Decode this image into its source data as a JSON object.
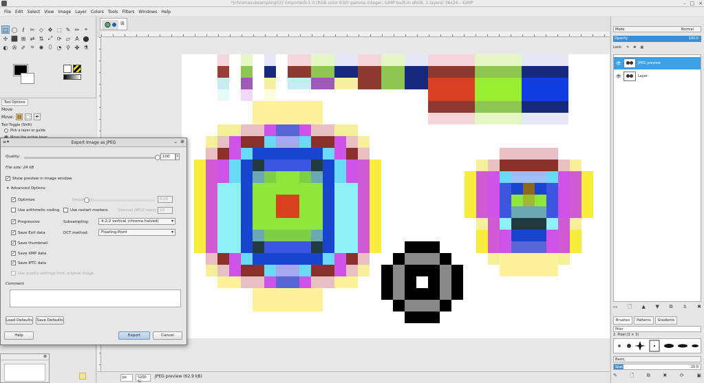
{
  "window": {
    "title": "*[chromasubsampling02] (imported)-1.0 (RGB color 8-bit gamma integer, GIMP built-in sRGB, 1 layers) 36x24 – GIMP",
    "controls": [
      "–",
      "□",
      "×"
    ]
  },
  "menu": [
    "File",
    "Edit",
    "Select",
    "View",
    "Image",
    "Layer",
    "Colors",
    "Tools",
    "Filters",
    "Windows",
    "Help"
  ],
  "toolbox": {
    "tools": [
      "□",
      "◯",
      "ℓ",
      "✂",
      "◇",
      "✥",
      "⬚",
      "✎",
      "✏",
      "⌖",
      "✢",
      "⬛",
      "⊞",
      "⇄",
      "⇅",
      "⤢",
      "⟳",
      "▱",
      "A",
      "⬤",
      "◐",
      "✇",
      "✐",
      "⌗",
      "✺",
      "⬯",
      "◔",
      "⚲",
      "✤",
      "⚗"
    ],
    "selected_index": 0
  },
  "tool_options": {
    "tab_label": "Tool Options",
    "title": "Move",
    "move_label": "Move:",
    "toggle_label": "Tool Toggle  (Shift)",
    "radio1": "Pick a layer or guide",
    "radio2": "Move the active layer"
  },
  "dialog": {
    "title": "Export Image as JPEG",
    "quality_label": "Quality:",
    "quality_value": "100",
    "file_size": "File size: 24 kB",
    "show_preview": "Show preview in image window",
    "advanced_options": "Advanced Options",
    "optimize": "Optimize",
    "smoothing_label": "Smoothing:",
    "smoothing_value": "0.00",
    "arithmetic": "Use arithmetic coding",
    "restart_markers": "Use restart markers",
    "interval_label": "Interval (MCU rows):",
    "interval_value": "10",
    "progressive": "Progressive",
    "subsampling_label": "Subsampling:",
    "subsampling_value": "4:2:2 vertical (chroma halved)",
    "save_exif": "Save Exif data",
    "dct_label": "DCT method:",
    "dct_value": "Floating-Point",
    "save_thumbnail": "Save thumbnail",
    "save_xmp": "Save XMP data",
    "save_iptc": "Save IPTC data",
    "use_quality": "Use quality settings from original image",
    "comment_label": "Comment",
    "load_defaults": "Load Defaults",
    "save_defaults": "Save Defaults",
    "help": "Help",
    "export": "Export",
    "cancel": "Cancel"
  },
  "status": {
    "unit": "px",
    "zoom": "5200 %",
    "text": "JPEG preview (62.9 kB)"
  },
  "layers_panel": {
    "mode_label": "Mode",
    "mode_value": "Normal",
    "opacity_label": "Opacity",
    "opacity_value": "100.0",
    "lock_label": "Lock:",
    "layers": [
      {
        "name": "JPEG preview",
        "selected": true
      },
      {
        "name": "Layer",
        "selected": false
      }
    ]
  },
  "brushes_panel": {
    "tabs": [
      "Brushes",
      "Patterns",
      "Gradients"
    ],
    "filter_placeholder": "filter",
    "current_brush": "2. Pixel (3 × 3)",
    "preset": "Basic,",
    "spacing_label": "Spacing",
    "spacing_value": "20.0"
  },
  "colors": {
    "accent": "#3f8ccf",
    "selected_layer": "#3fa0e6"
  }
}
